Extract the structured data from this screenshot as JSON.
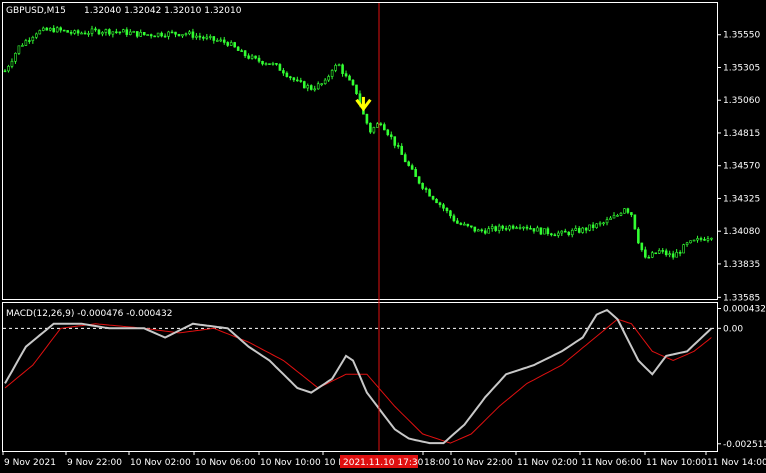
{
  "colors": {
    "background": "#000000",
    "frame": "#ffffff",
    "candle": "#33ff33",
    "macd_main": "#c8c8c8",
    "macd_signal": "#e01010",
    "crosshair": "#e01010",
    "arrow": "#ffff00",
    "time_badge": "#e01010"
  },
  "chart_data": [
    {
      "type": "candlestick",
      "header": {
        "symbol": "GBPUSD,M15",
        "ohlc": "1.32040 1.32042 1.32010 1.32010"
      },
      "y_ticks": [
        "1.35550",
        "1.35305",
        "1.35060",
        "1.34815",
        "1.34570",
        "1.34325",
        "1.34080",
        "1.33835",
        "1.33585"
      ],
      "ylim": [
        1.3358,
        1.3578
      ],
      "close_path": [
        [
          0,
          1.3528
        ],
        [
          4,
          1.3546
        ],
        [
          9,
          1.3557
        ],
        [
          14,
          1.3559
        ],
        [
          20,
          1.3556
        ],
        [
          28,
          1.3558
        ],
        [
          34,
          1.3557
        ],
        [
          40,
          1.3555
        ],
        [
          46,
          1.3556
        ],
        [
          52,
          1.3556
        ],
        [
          58,
          1.3552
        ],
        [
          64,
          1.3549
        ],
        [
          68,
          1.3541
        ],
        [
          72,
          1.3536
        ],
        [
          76,
          1.3534
        ],
        [
          80,
          1.3528
        ],
        [
          84,
          1.3519
        ],
        [
          88,
          1.3515
        ],
        [
          92,
          1.3519
        ],
        [
          94,
          1.353
        ],
        [
          96,
          1.3532
        ],
        [
          98,
          1.3523
        ],
        [
          101,
          1.3512
        ],
        [
          103,
          1.3495
        ],
        [
          105,
          1.3483
        ],
        [
          108,
          1.349
        ],
        [
          111,
          1.3478
        ],
        [
          114,
          1.3465
        ],
        [
          118,
          1.3448
        ],
        [
          122,
          1.3436
        ],
        [
          124,
          1.3431
        ],
        [
          130,
          1.3414
        ],
        [
          136,
          1.3408
        ],
        [
          142,
          1.341
        ],
        [
          148,
          1.3413
        ],
        [
          154,
          1.3408
        ],
        [
          160,
          1.3406
        ],
        [
          166,
          1.3409
        ],
        [
          172,
          1.3414
        ],
        [
          176,
          1.342
        ],
        [
          178,
          1.3426
        ],
        [
          180,
          1.3421
        ],
        [
          182,
          1.3401
        ],
        [
          184,
          1.3387
        ],
        [
          188,
          1.3393
        ],
        [
          192,
          1.3389
        ],
        [
          196,
          1.3398
        ],
        [
          200,
          1.3402
        ],
        [
          203,
          1.3405
        ]
      ],
      "arrow_at": 103
    },
    {
      "type": "line",
      "title": "MACD(12,26,9) -0.000476 -0.000432",
      "y_ticks": [
        "0.000432",
        "0.00",
        "-0.002515"
      ],
      "ylim": [
        -0.00265,
        0.00053
      ],
      "series": [
        {
          "name": "main",
          "points": [
            [
              0,
              -0.0012
            ],
            [
              6,
              -0.0004
            ],
            [
              14,
              0.0001
            ],
            [
              22,
              0.0001
            ],
            [
              30,
              0.0
            ],
            [
              40,
              0.0
            ],
            [
              46,
              -0.0002
            ],
            [
              54,
              0.0001
            ],
            [
              64,
              0.0
            ],
            [
              70,
              -0.0004
            ],
            [
              76,
              -0.0007
            ],
            [
              84,
              -0.0013
            ],
            [
              88,
              -0.0014
            ],
            [
              94,
              -0.0011
            ],
            [
              98,
              -0.0006
            ],
            [
              100,
              -0.0007
            ],
            [
              104,
              -0.0014
            ],
            [
              108,
              -0.0018
            ],
            [
              112,
              -0.0022
            ],
            [
              116,
              -0.0024
            ],
            [
              122,
              -0.0025
            ],
            [
              126,
              -0.0025
            ],
            [
              132,
              -0.0021
            ],
            [
              138,
              -0.0015
            ],
            [
              144,
              -0.001
            ],
            [
              152,
              -0.0008
            ],
            [
              160,
              -0.0005
            ],
            [
              166,
              -0.0002
            ],
            [
              170,
              0.0003
            ],
            [
              173,
              0.0004
            ],
            [
              176,
              0.0002
            ],
            [
              182,
              -0.0007
            ],
            [
              186,
              -0.001
            ],
            [
              190,
              -0.0006
            ],
            [
              196,
              -0.0005
            ],
            [
              203,
              0.0
            ]
          ]
        },
        {
          "name": "signal",
          "points": [
            [
              0,
              -0.0013
            ],
            [
              8,
              -0.0008
            ],
            [
              16,
              0.0
            ],
            [
              26,
              0.0001
            ],
            [
              40,
              0.0
            ],
            [
              50,
              -0.0001
            ],
            [
              60,
              0.0
            ],
            [
              70,
              -0.0003
            ],
            [
              80,
              -0.0007
            ],
            [
              90,
              -0.0013
            ],
            [
              98,
              -0.001
            ],
            [
              104,
              -0.001
            ],
            [
              112,
              -0.0017
            ],
            [
              120,
              -0.0023
            ],
            [
              128,
              -0.0025
            ],
            [
              134,
              -0.0023
            ],
            [
              142,
              -0.0017
            ],
            [
              150,
              -0.0012
            ],
            [
              160,
              -0.0008
            ],
            [
              168,
              -0.0003
            ],
            [
              176,
              0.0002
            ],
            [
              180,
              0.0001
            ],
            [
              186,
              -0.0005
            ],
            [
              192,
              -0.0007
            ],
            [
              198,
              -0.0005
            ],
            [
              203,
              -0.0002
            ]
          ]
        }
      ]
    }
  ],
  "time_axis": {
    "labels": [
      "9 Nov 2021",
      "9 Nov 22:00",
      "10 Nov 02:00",
      "10 Nov 06:00",
      "10 Nov 10:00",
      "10 Nov 14:00",
      "18:00",
      "10 Nov 22:00",
      "11 Nov 02:00",
      "11 Nov 06:00",
      "11 Nov 10:00",
      "11 Nov 14:00"
    ],
    "crosshair_label": "2021.11.10 17:30"
  }
}
